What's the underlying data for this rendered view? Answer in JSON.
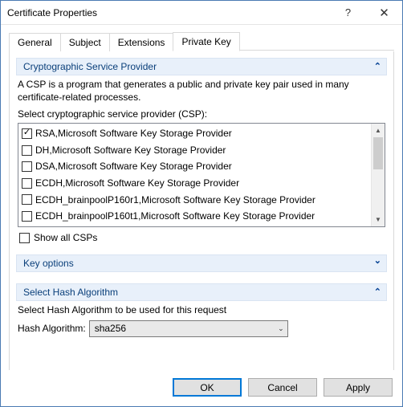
{
  "window": {
    "title": "Certificate Properties"
  },
  "tabs": {
    "general": "General",
    "subject": "Subject",
    "extensions": "Extensions",
    "private_key": "Private Key"
  },
  "csp_section": {
    "title": "Cryptographic Service Provider",
    "description": "A CSP is a program that generates a public and private key pair used in many certificate-related processes.",
    "select_label": "Select cryptographic service provider (CSP):",
    "items": [
      {
        "label": "RSA,Microsoft Software Key Storage Provider",
        "checked": true
      },
      {
        "label": "DH,Microsoft Software Key Storage Provider",
        "checked": false
      },
      {
        "label": "DSA,Microsoft Software Key Storage Provider",
        "checked": false
      },
      {
        "label": "ECDH,Microsoft Software Key Storage Provider",
        "checked": false
      },
      {
        "label": "ECDH_brainpoolP160r1,Microsoft Software Key Storage Provider",
        "checked": false
      },
      {
        "label": "ECDH_brainpoolP160t1,Microsoft Software Key Storage Provider",
        "checked": false
      }
    ],
    "show_all_label": "Show all CSPs"
  },
  "key_options_section": {
    "title": "Key options"
  },
  "hash_section": {
    "title": "Select Hash Algorithm",
    "description": "Select Hash Algorithm to be used for this request",
    "field_label": "Hash Algorithm:",
    "value": "sha256"
  },
  "buttons": {
    "ok": "OK",
    "cancel": "Cancel",
    "apply": "Apply"
  }
}
